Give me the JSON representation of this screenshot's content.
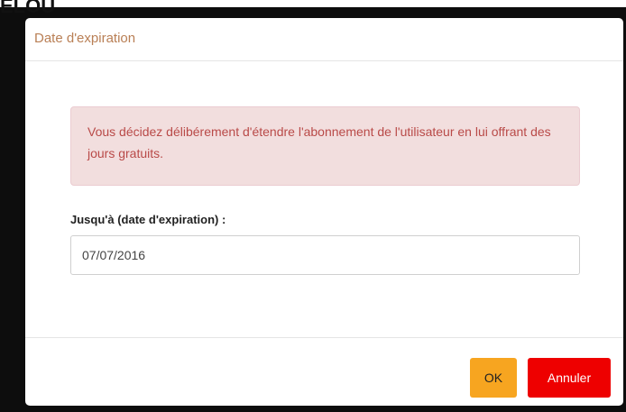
{
  "background": {
    "text": "ELOU"
  },
  "modal": {
    "title": "Date d'expiration",
    "alert_text": "Vous décidez délibérement d'étendre l'abonnement de l'utilisateur en lui offrant des jours gratuits.",
    "field_label": "Jusqu'à (date d'expiration) :",
    "date_value": "07/07/2016",
    "ok_label": "OK",
    "cancel_label": "Annuler"
  },
  "colors": {
    "title": "#b97f55",
    "alert_bg": "#f2dede",
    "alert_text": "#b94a48",
    "ok_button": "#f7a520",
    "cancel_button": "#ee0000"
  }
}
